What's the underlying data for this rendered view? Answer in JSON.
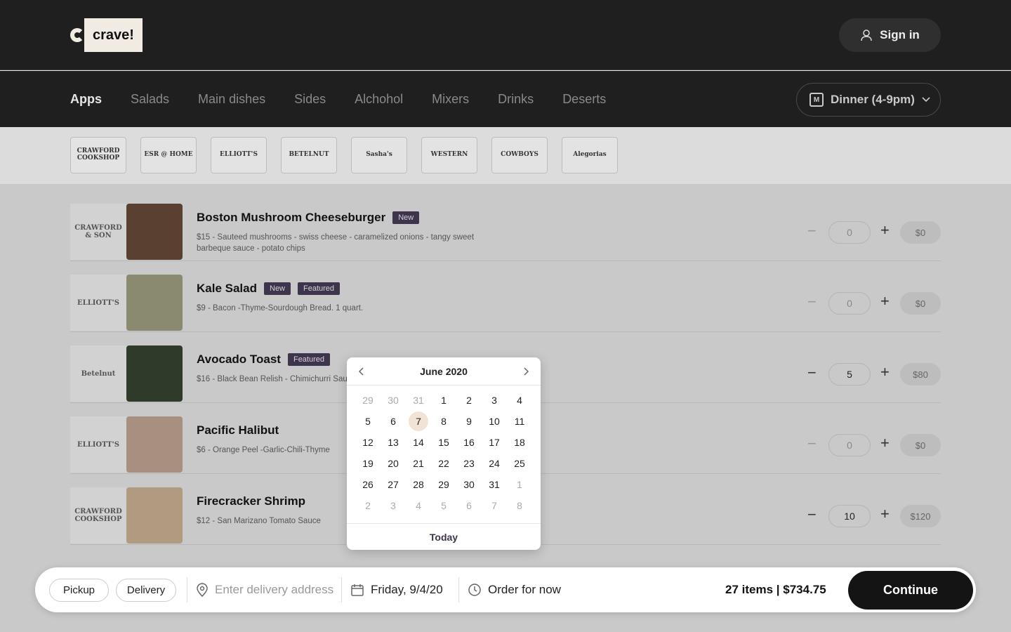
{
  "header": {
    "logo_text": "crave!",
    "signin_label": "Sign in"
  },
  "categories": {
    "items": [
      "Apps",
      "Salads",
      "Main dishes",
      "Sides",
      "Alchohol",
      "Mixers",
      "Drinks",
      "Deserts"
    ],
    "active": "Apps",
    "meal_period": "Dinner (4-9pm)"
  },
  "restaurants": [
    "CRAWFORD COOKSHOP",
    "ESR @ HOME",
    "ELLIOTT'S",
    "BETELNUT",
    "Sasha's",
    "WESTERN",
    "COWBOYS",
    "Alegorias"
  ],
  "menu": [
    {
      "logo": "CRAWFORD & SON",
      "name": "Boston Mushroom Cheeseburger",
      "tags": [
        "New"
      ],
      "desc": "$15 - Sauteed mushrooms - swiss cheese - caramelized onions - tangy sweet barbeque sauce - potato chips",
      "qty": "0",
      "price": "$0",
      "img_color": "#5a4030"
    },
    {
      "logo": "ELLIOTT'S",
      "name": "Kale Salad",
      "tags": [
        "New",
        "Featured"
      ],
      "desc": "$9 - Bacon -Thyme-Sourdough Bread. 1 quart.",
      "qty": "0",
      "price": "$0",
      "img_color": "#8a8a70"
    },
    {
      "logo": "Betelnut",
      "name": "Avocado Toast",
      "tags": [
        "Featured"
      ],
      "desc": "$16 - Black Bean Relish - Chimichurri Sau",
      "qty": "5",
      "price": "$80",
      "img_color": "#2f3a2a"
    },
    {
      "logo": "ELLIOTT'S",
      "name": "Pacific Halibut",
      "tags": [],
      "desc": "$6 - Orange Peel -Garlic-Chili-Thyme",
      "qty": "0",
      "price": "$0",
      "img_color": "#a89080"
    },
    {
      "logo": "CRAWFORD COOKSHOP",
      "name": "Firecracker Shrimp",
      "tags": [],
      "desc": "$12 - San Marizano Tomato Sauce",
      "qty": "10",
      "price": "$120",
      "img_color": "#b09a80"
    }
  ],
  "calendar": {
    "title": "June 2020",
    "days": [
      {
        "d": "29",
        "m": true
      },
      {
        "d": "30",
        "m": true
      },
      {
        "d": "31",
        "m": true
      },
      {
        "d": "1"
      },
      {
        "d": "2"
      },
      {
        "d": "3"
      },
      {
        "d": "4"
      },
      {
        "d": "5"
      },
      {
        "d": "6"
      },
      {
        "d": "7",
        "sel": true
      },
      {
        "d": "8"
      },
      {
        "d": "9"
      },
      {
        "d": "10"
      },
      {
        "d": "11"
      },
      {
        "d": "12"
      },
      {
        "d": "13"
      },
      {
        "d": "14"
      },
      {
        "d": "15"
      },
      {
        "d": "16"
      },
      {
        "d": "17"
      },
      {
        "d": "18"
      },
      {
        "d": "19"
      },
      {
        "d": "20"
      },
      {
        "d": "21"
      },
      {
        "d": "22"
      },
      {
        "d": "23"
      },
      {
        "d": "24"
      },
      {
        "d": "25"
      },
      {
        "d": "26"
      },
      {
        "d": "27"
      },
      {
        "d": "28"
      },
      {
        "d": "29"
      },
      {
        "d": "30"
      },
      {
        "d": "31"
      },
      {
        "d": "1",
        "m": true
      },
      {
        "d": "2",
        "m": true
      },
      {
        "d": "3",
        "m": true
      },
      {
        "d": "4",
        "m": true
      },
      {
        "d": "5",
        "m": true
      },
      {
        "d": "6",
        "m": true
      },
      {
        "d": "7",
        "m": true
      },
      {
        "d": "8",
        "m": true
      }
    ],
    "today_label": "Today"
  },
  "order_bar": {
    "pickup_label": "Pickup",
    "delivery_label": "Delivery",
    "address_placeholder": "Enter delivery address",
    "date_value": "Friday, 9/4/20",
    "time_value": "Order for now",
    "summary": "27 items | $734.75",
    "continue_label": "Continue"
  }
}
